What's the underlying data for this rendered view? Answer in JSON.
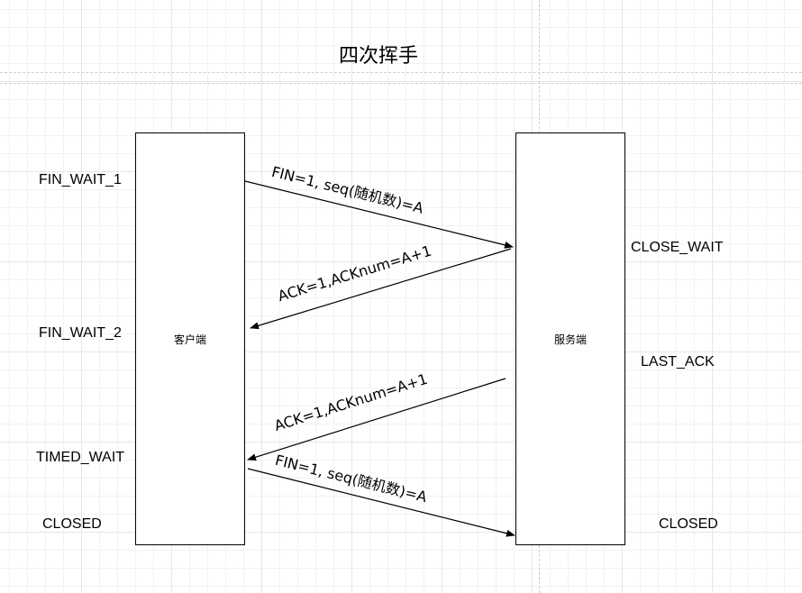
{
  "title": "四次挥手",
  "client": {
    "label": "客户端"
  },
  "server": {
    "label": "服务端"
  },
  "client_states": [
    "FIN_WAIT_1",
    "FIN_WAIT_2",
    "TIMED_WAIT",
    "CLOSED"
  ],
  "server_states": [
    "CLOSE_WAIT",
    "LAST_ACK",
    "CLOSED"
  ],
  "messages": [
    "FIN=1, seq(随机数)=A",
    "ACK=1,ACKnum=A+1",
    "ACK=1,ACKnum=A+1",
    "FIN=1, seq(随机数)=A"
  ]
}
